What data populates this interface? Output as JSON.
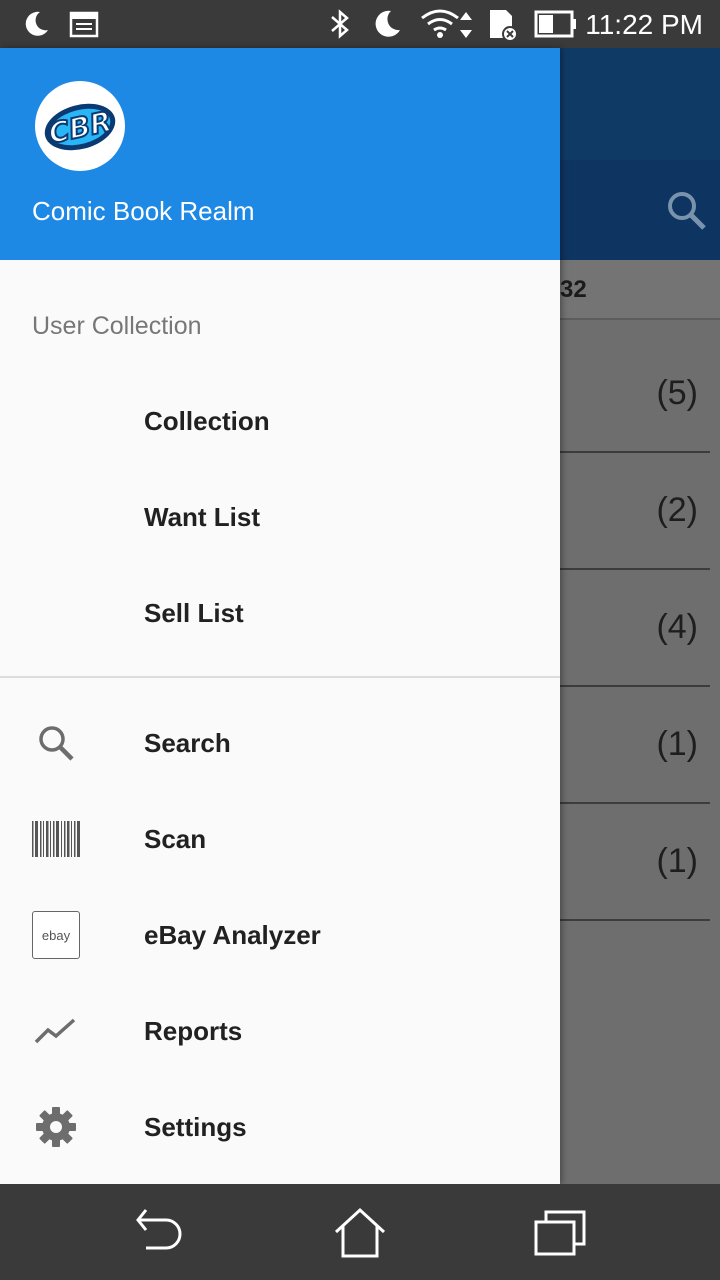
{
  "status_bar": {
    "time": "11:22 PM",
    "icons": [
      "moon-icon",
      "calendar-icon",
      "bluetooth-icon",
      "do-not-disturb-icon",
      "wifi-icon",
      "sd-card-icon",
      "battery-icon"
    ]
  },
  "background": {
    "header_text": "32",
    "counts": [
      "(5)",
      "(2)",
      "(4)",
      "(1)",
      "(1)"
    ]
  },
  "drawer": {
    "app_name": "Comic Book Realm",
    "logo_text": "CBR",
    "section_title": "User Collection",
    "collection_items": [
      {
        "label": "Collection"
      },
      {
        "label": "Want List"
      },
      {
        "label": "Sell List"
      }
    ],
    "tool_items": [
      {
        "label": "Search",
        "icon": "search-icon"
      },
      {
        "label": "Scan",
        "icon": "barcode-icon"
      },
      {
        "label": "eBay Analyzer",
        "icon": "ebay-icon",
        "icon_text": "ebay"
      },
      {
        "label": "Reports",
        "icon": "chart-line-icon"
      },
      {
        "label": "Settings",
        "icon": "gear-icon"
      }
    ]
  },
  "colors": {
    "header_blue": "#1e88e5",
    "dark_blue": "#103a66",
    "status_bar": "#3a3a3a"
  }
}
